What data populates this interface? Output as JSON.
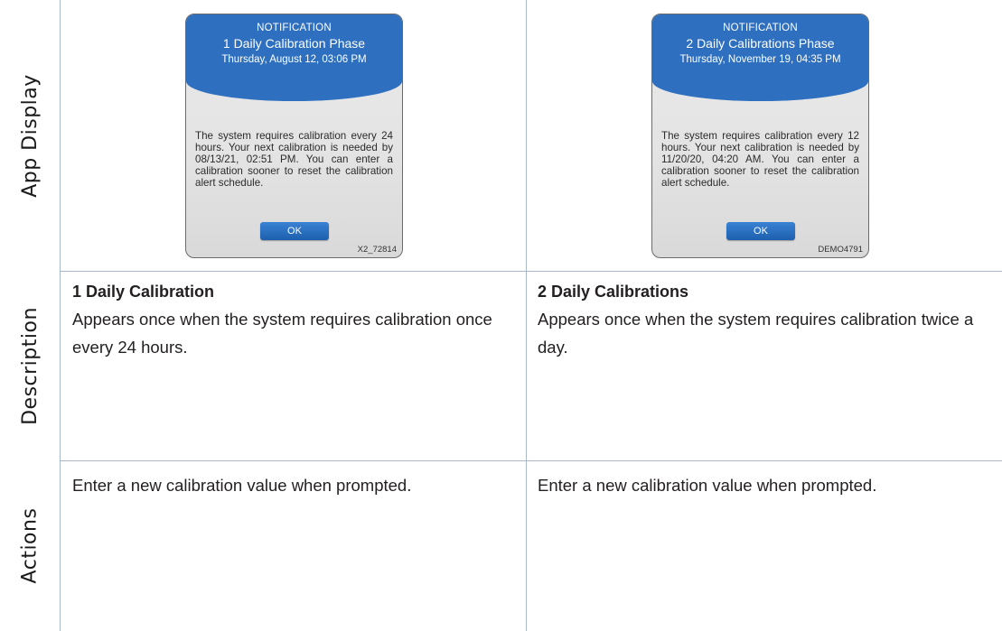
{
  "rows": {
    "app_display": "App Display",
    "description": "Description",
    "actions": "Actions"
  },
  "col1": {
    "screen": {
      "notification": "NOTIFICATION",
      "title": "1 Daily Calibration Phase",
      "date": "Thursday, August 12, 03:06 PM",
      "body": "The system requires calibration every 24 hours. Your next calibration is needed by 08/13/21, 02:51 PM. You can enter a calibration sooner to reset the calibration alert schedule.",
      "ok": "OK",
      "image_id": "X2_72814"
    },
    "desc_title": "1 Daily Calibration",
    "desc_text": "Appears once when the system requires calibration once every 24 hours.",
    "action": "Enter a new calibration value when prompted."
  },
  "col2": {
    "screen": {
      "notification": "NOTIFICATION",
      "title": "2 Daily Calibrations Phase",
      "date": "Thursday, November 19, 04:35 PM",
      "body": "The system requires calibration every 12 hours. Your next calibration is needed by 11/20/20, 04:20 AM. You can enter a calibration sooner to reset the calibration alert schedule.",
      "ok": "OK",
      "image_id": "DEMO4791"
    },
    "desc_title": "2 Daily Calibrations",
    "desc_text": "Appears once when the system requires calibration twice a day.",
    "action": "Enter a new calibration value when prompted."
  },
  "colors": {
    "grid_line": "#a9b7d1",
    "header_blue": "#2e6fbf",
    "button_blue": "#1d5fae"
  }
}
